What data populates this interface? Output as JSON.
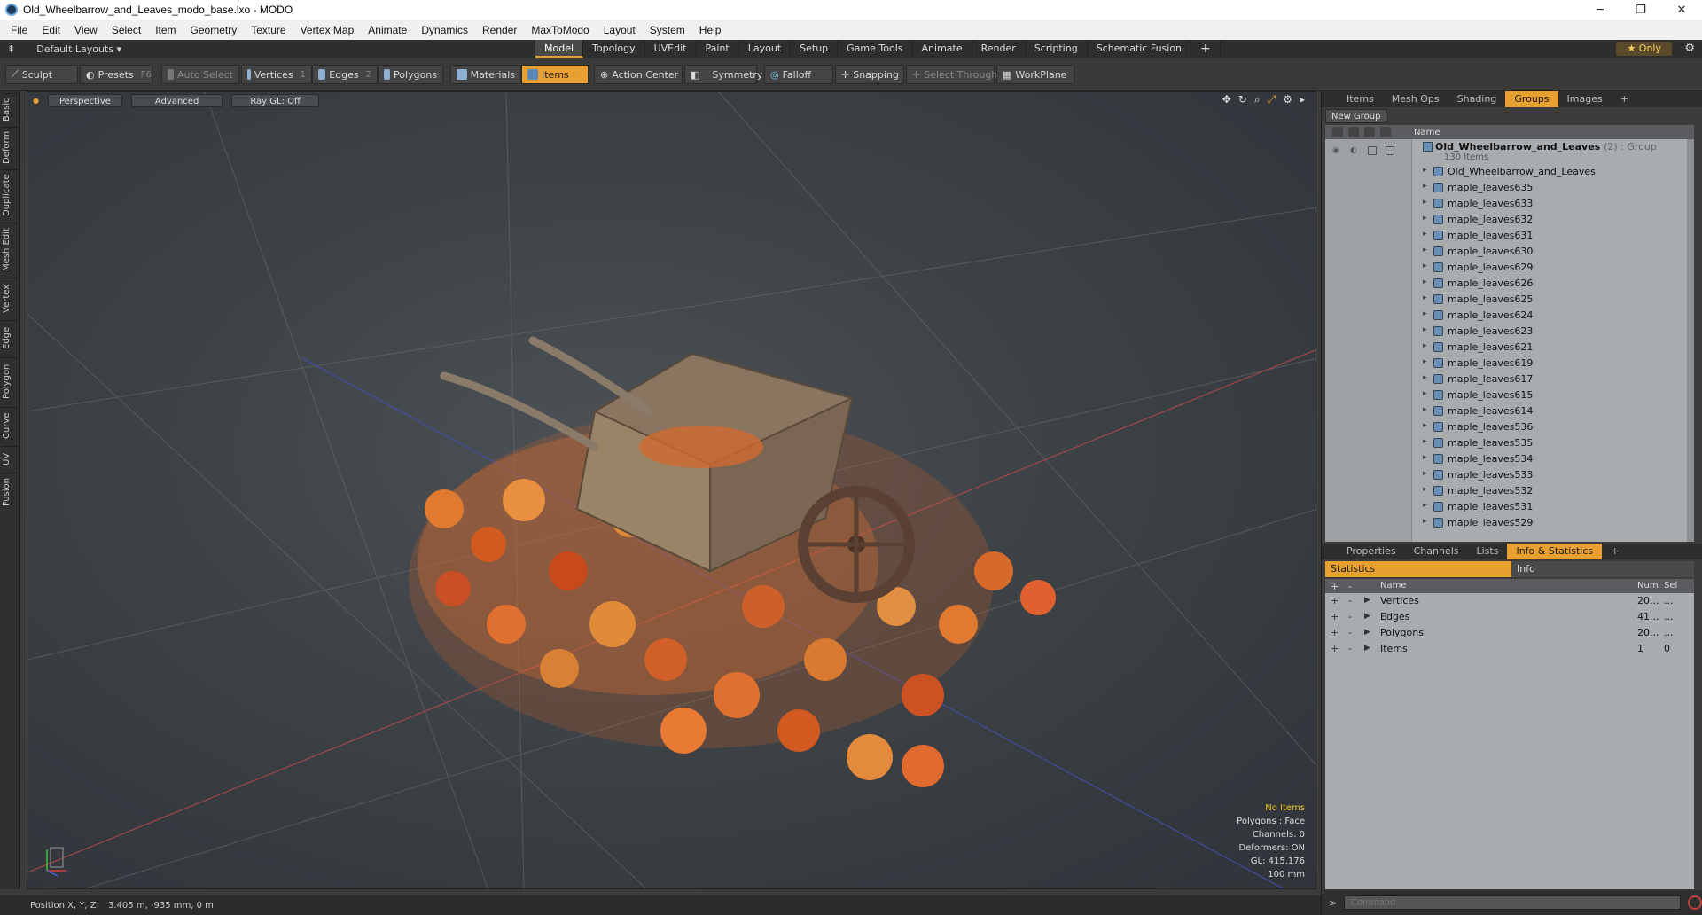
{
  "window": {
    "title": "Old_Wheelbarrow_and_Leaves_modo_base.lxo - MODO"
  },
  "menu": [
    "File",
    "Edit",
    "View",
    "Select",
    "Item",
    "Geometry",
    "Texture",
    "Vertex Map",
    "Animate",
    "Dynamics",
    "Render",
    "MaxToModo",
    "Layout",
    "System",
    "Help"
  ],
  "layout": {
    "label": "Default Layouts ▾"
  },
  "tabs": [
    "Model",
    "Topology",
    "UVEdit",
    "Paint",
    "Layout",
    "Setup",
    "Game Tools",
    "Animate",
    "Render",
    "Scripting",
    "Schematic Fusion"
  ],
  "only_label": "★  Only",
  "toolbar": {
    "sculpt": "Sculpt",
    "presets": "Presets",
    "presets_key": "F6",
    "auto_select": "Auto Select",
    "vertices": "Vertices",
    "vertices_key": "1",
    "edges": "Edges",
    "edges_key": "2",
    "polygons": "Polygons",
    "materials": "Materials",
    "items": "Items",
    "action_center": "Action Center",
    "symmetry": "Symmetry",
    "falloff": "Falloff",
    "snapping": "Snapping",
    "select_through": "Select Through",
    "workplane": "WorkPlane"
  },
  "left_tabs": [
    "Basic",
    "Deform",
    "Duplicate",
    "Mesh Edit",
    "Vertex",
    "Edge",
    "Polygon",
    "Curve",
    "UV",
    "Fusion"
  ],
  "viewport": {
    "perspective": "Perspective",
    "advanced": "Advanced",
    "raygl": "Ray GL: Off",
    "info": [
      "No Items",
      "Polygons : Face",
      "Channels: 0",
      "Deformers: ON",
      "GL: 415,176",
      "100 mm"
    ]
  },
  "status": {
    "label": "Position X, Y, Z:",
    "value": "3.405 m, -935 mm, 0 m"
  },
  "top_panel": {
    "tabs": [
      "Items",
      "Mesh Ops",
      "Shading",
      "Groups",
      "Images"
    ],
    "active": "Groups",
    "new_group": "New Group",
    "name_header": "Name",
    "group_name": "Old_Wheelbarrow_and_Leaves",
    "group_suffix": "(2) : Group",
    "group_count": "130 Items",
    "items": [
      "Old_Wheelbarrow_and_Leaves",
      "maple_leaves635",
      "maple_leaves633",
      "maple_leaves632",
      "maple_leaves631",
      "maple_leaves630",
      "maple_leaves629",
      "maple_leaves626",
      "maple_leaves625",
      "maple_leaves624",
      "maple_leaves623",
      "maple_leaves621",
      "maple_leaves619",
      "maple_leaves617",
      "maple_leaves615",
      "maple_leaves614",
      "maple_leaves536",
      "maple_leaves535",
      "maple_leaves534",
      "maple_leaves533",
      "maple_leaves532",
      "maple_leaves531",
      "maple_leaves529"
    ]
  },
  "bottom_panel": {
    "tabs": [
      "Properties",
      "Channels",
      "Lists",
      "Info & Statistics"
    ],
    "active": "Info & Statistics",
    "subtabs": [
      "Statistics",
      "Info"
    ],
    "headers": {
      "name": "Name",
      "num": "Num",
      "sel": "Sel"
    },
    "rows": [
      {
        "name": "Vertices",
        "num": "20...",
        "sel": "..."
      },
      {
        "name": "Edges",
        "num": "41...",
        "sel": "..."
      },
      {
        "name": "Polygons",
        "num": "20...",
        "sel": "..."
      },
      {
        "name": "Items",
        "num": "1",
        "sel": "0"
      }
    ]
  },
  "command": {
    "placeholder": "Command"
  },
  "colors": {
    "accent": "#e8a030",
    "panel_bg": "#a9acaf"
  }
}
